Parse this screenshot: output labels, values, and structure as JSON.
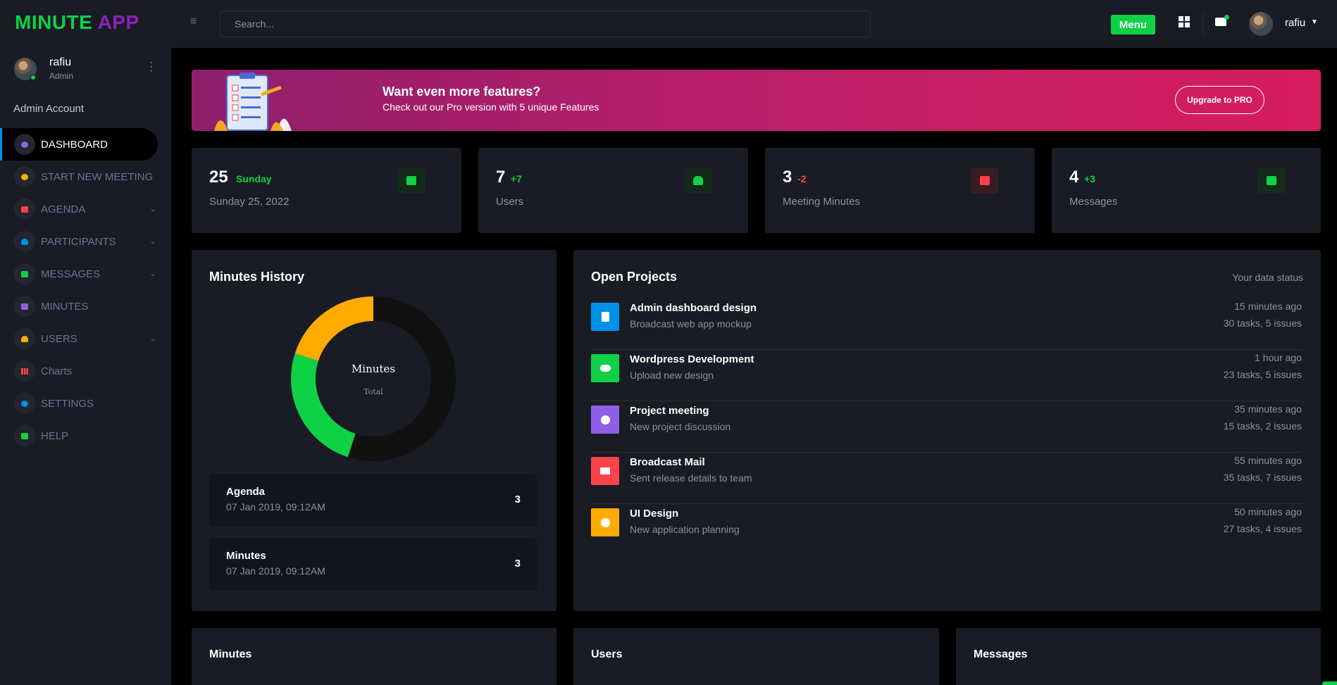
{
  "app": {
    "logo_part1": "MINUTE",
    "logo_part2": " APP",
    "brand_green": "#0ed145",
    "brand_purple": "#8f1fbf"
  },
  "topbar": {
    "menu_icon": "hamburger-icon",
    "search_placeholder": "Search...",
    "menu_label": "Menu",
    "apps_icon": "grid-icon",
    "mail_icon": "envelope-icon",
    "user_name": "rafiu"
  },
  "sidebar": {
    "user_name": "rafiu",
    "user_role": "Admin",
    "section_label": "Admin Account",
    "items": [
      {
        "label": "DASHBOARD",
        "icon": "speedometer-icon",
        "color": "#8f5fe8",
        "active": true
      },
      {
        "label": "START NEW MEETING",
        "icon": "speedometer-icon",
        "color": "#ffab00"
      },
      {
        "label": "AGENDA",
        "icon": "folder-icon",
        "color": "#fc424a",
        "chevron": true
      },
      {
        "label": "PARTICIPANTS",
        "icon": "users-icon",
        "color": "#0090e7",
        "chevron": true
      },
      {
        "label": "MESSAGES",
        "icon": "chat-icon",
        "color": "#0ed145",
        "chevron": true
      },
      {
        "label": "MINUTES",
        "icon": "folder-icon",
        "color": "#8f5fe8"
      },
      {
        "label": "USERS",
        "icon": "users-icon",
        "color": "#ffab00",
        "chevron": true
      },
      {
        "label": "Charts",
        "icon": "chart-icon",
        "color": "#fc424a"
      },
      {
        "label": "SETTINGS",
        "icon": "gear-icon",
        "color": "#0090e7"
      },
      {
        "label": "HELP",
        "icon": "help-icon",
        "color": "#0ed145"
      }
    ]
  },
  "banner": {
    "title": "Want even more features?",
    "subtitle": "Check out our Pro version with 5 unique Features",
    "button": "Upgrade to PRO"
  },
  "stats": [
    {
      "value": "25",
      "delta": "Sunday",
      "delta_color": "#0ed145",
      "label": "Sunday 25, 2022",
      "icon": "calendar-icon",
      "icon_color": "#0ed145",
      "icon_bg": "#132a1d"
    },
    {
      "value": "7",
      "delta": "+7",
      "delta_color": "#0ed145",
      "label": "Users",
      "icon": "users-icon",
      "icon_color": "#0ed145",
      "icon_bg": "#132a1d"
    },
    {
      "value": "3",
      "delta": "-2",
      "delta_color": "#fc424a",
      "label": "Meeting Minutes",
      "icon": "folder-lock-icon",
      "icon_color": "#fc424a",
      "icon_bg": "#3a1d22"
    },
    {
      "value": "4",
      "delta": "+3",
      "delta_color": "#0ed145",
      "label": "Messages",
      "icon": "chat-icon",
      "icon_color": "#0ed145",
      "icon_bg": "#132a1d"
    }
  ],
  "minutes_history": {
    "title": "Minutes History",
    "donut_center_title": "Minutes",
    "donut_center_sub": "Total",
    "segments": [
      {
        "value": 55,
        "color": "#111111"
      },
      {
        "value": 25,
        "color": "#0ed145"
      },
      {
        "value": 20,
        "color": "#ffab00"
      }
    ],
    "rows": [
      {
        "title": "Agenda",
        "date": "07 Jan 2019, 09:12AM",
        "count": "3"
      },
      {
        "title": "Minutes",
        "date": "07 Jan 2019, 09:12AM",
        "count": "3"
      }
    ]
  },
  "open_projects": {
    "title": "Open Projects",
    "status_label": "Your data status",
    "items": [
      {
        "title": "Admin dashboard design",
        "sub": "Broadcast web app mockup",
        "time": "15 minutes ago",
        "tasks": "30 tasks, 5 issues",
        "icon": "document-icon",
        "color": "#0090e7"
      },
      {
        "title": "Wordpress Development",
        "sub": "Upload new design",
        "time": "1 hour ago",
        "tasks": "23 tasks, 5 issues",
        "icon": "cloud-upload-icon",
        "color": "#0ed145"
      },
      {
        "title": "Project meeting",
        "sub": "New project discussion",
        "time": "35 minutes ago",
        "tasks": "15 tasks, 2 issues",
        "icon": "clock-icon",
        "color": "#8f5fe8"
      },
      {
        "title": "Broadcast Mail",
        "sub": "Sent release details to team",
        "time": "55 minutes ago",
        "tasks": "35 tasks, 7 issues",
        "icon": "mail-open-icon",
        "color": "#fc424a"
      },
      {
        "title": "UI Design",
        "sub": "New application planning",
        "time": "50 minutes ago",
        "tasks": "27 tasks, 4 issues",
        "icon": "pie-icon",
        "color": "#ffab00"
      }
    ]
  },
  "bottom_panels": {
    "minutes": "Minutes",
    "users": "Users",
    "messages": "Messages"
  }
}
